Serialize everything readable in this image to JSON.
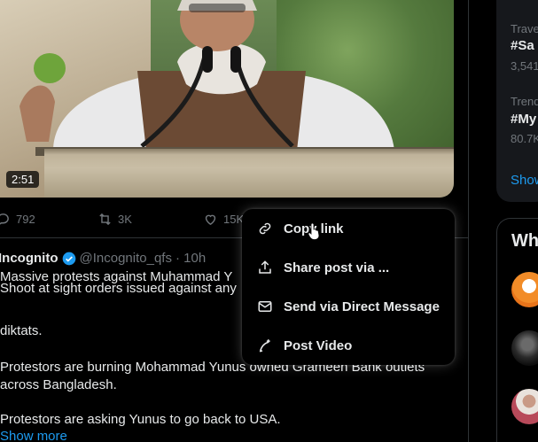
{
  "video": {
    "duration": "2:51"
  },
  "actions": {
    "replies": "792",
    "reposts": "3K",
    "likes": "15K"
  },
  "post": {
    "author": "Incognito",
    "handle": "@Incognito_qfs",
    "time": "· 10h",
    "lines": [
      "Massive protests against Muhammad Y",
      "Shoot at sight orders issued against any",
      "diktats.",
      "Protestors are burning Mohammad Yunus owned Grameen Bank outlets",
      "across Bangladesh.",
      "Protestors are asking Yunus to go back to USA."
    ],
    "show_more": "Show more"
  },
  "menu": {
    "items": [
      {
        "label": "Copy link",
        "icon": "link-icon"
      },
      {
        "label": "Share post via ...",
        "icon": "share-icon"
      },
      {
        "label": "Send via Direct Message",
        "icon": "envelope-icon"
      },
      {
        "label": "Post Video",
        "icon": "post-video-icon"
      }
    ]
  },
  "sidebar": {
    "trend1_category": "Trave",
    "trend1_tag": "#Sa",
    "trend1_count": "3,541",
    "trend2_category": "Trend",
    "trend2_tag": "#My",
    "trend2_count": "80.7K",
    "show_more": "Show",
    "who_title": "Wh"
  },
  "colors": {
    "accent": "#1d9bf0",
    "muted": "#71767b",
    "text": "#e7e9ea",
    "background": "#000000"
  }
}
